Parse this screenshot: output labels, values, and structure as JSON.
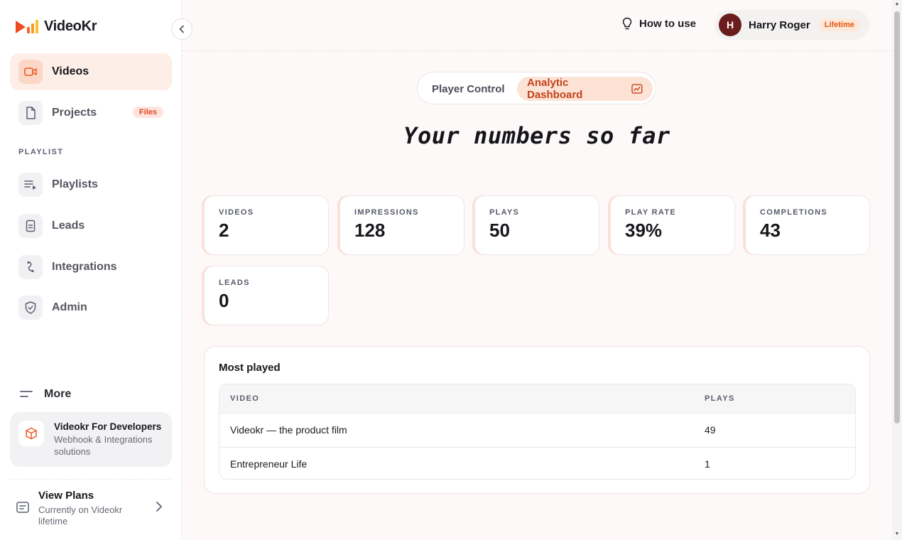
{
  "brand": {
    "name": "VideoKr"
  },
  "sidebar": {
    "items": [
      {
        "label": "Videos",
        "icon": "video-camera-icon",
        "active": true
      },
      {
        "label": "Projects",
        "icon": "file-icon",
        "badge": "Files"
      },
      {
        "label": "Playlists",
        "icon": "playlist-icon"
      },
      {
        "label": "Leads",
        "icon": "document-icon"
      },
      {
        "label": "Integrations",
        "icon": "integration-icon"
      },
      {
        "label": "Admin",
        "icon": "shield-icon"
      }
    ],
    "section_playlist": "PLAYLIST",
    "more_label": "More",
    "dev_card": {
      "title": "Videokr For Developers",
      "subtitle": "Webhook & Integrations solutions"
    },
    "plans": {
      "title": "View Plans",
      "subtitle": "Currently on Videokr lifetime"
    }
  },
  "header": {
    "how_to_use": "How to use",
    "user": {
      "initial": "H",
      "name": "Harry Roger",
      "plan_badge": "Lifetime"
    }
  },
  "toggle": {
    "player_control": "Player Control",
    "analytic_dashboard": "Analytic Dashboard",
    "active": "analytic_dashboard"
  },
  "page_title": "Your numbers so far",
  "stats": [
    {
      "label": "VIDEOS",
      "value": "2"
    },
    {
      "label": "IMPRESSIONS",
      "value": "128"
    },
    {
      "label": "PLAYS",
      "value": "50"
    },
    {
      "label": "PLAY RATE",
      "value": "39%"
    },
    {
      "label": "COMPLETIONS",
      "value": "43"
    },
    {
      "label": "LEADS",
      "value": "0"
    }
  ],
  "most_played": {
    "title": "Most played",
    "columns": [
      "VIDEO",
      "PLAYS"
    ],
    "rows": [
      {
        "video": "Videokr — the product film",
        "plays": "49"
      },
      {
        "video": "Entrepreneur Life",
        "plays": "1"
      }
    ]
  },
  "colors": {
    "accent": "#e9571f",
    "accent_soft": "#fde3d6",
    "avatar": "#6b1d1d"
  }
}
